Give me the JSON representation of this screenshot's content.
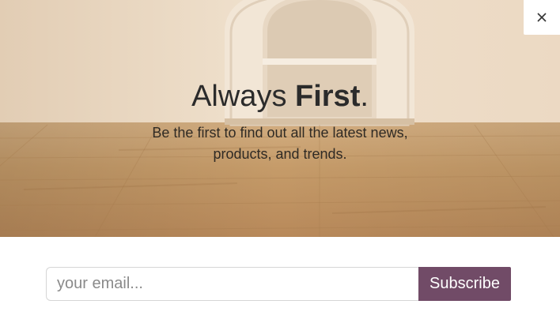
{
  "hero": {
    "headline_regular": "Always ",
    "headline_bold": "First",
    "headline_period": ".",
    "subtext_line1": "Be the first to find out all the latest news,",
    "subtext_line2": "products, and trends."
  },
  "close": {
    "icon": "close-icon",
    "aria_label": "Close"
  },
  "form": {
    "email_placeholder": "your email...",
    "email_value": "",
    "subscribe_label": "Subscribe"
  },
  "colors": {
    "accent": "#714b67",
    "headline_text": "#2b2b2b",
    "wall": "#ead9c3",
    "floor": "#c49a6c"
  }
}
